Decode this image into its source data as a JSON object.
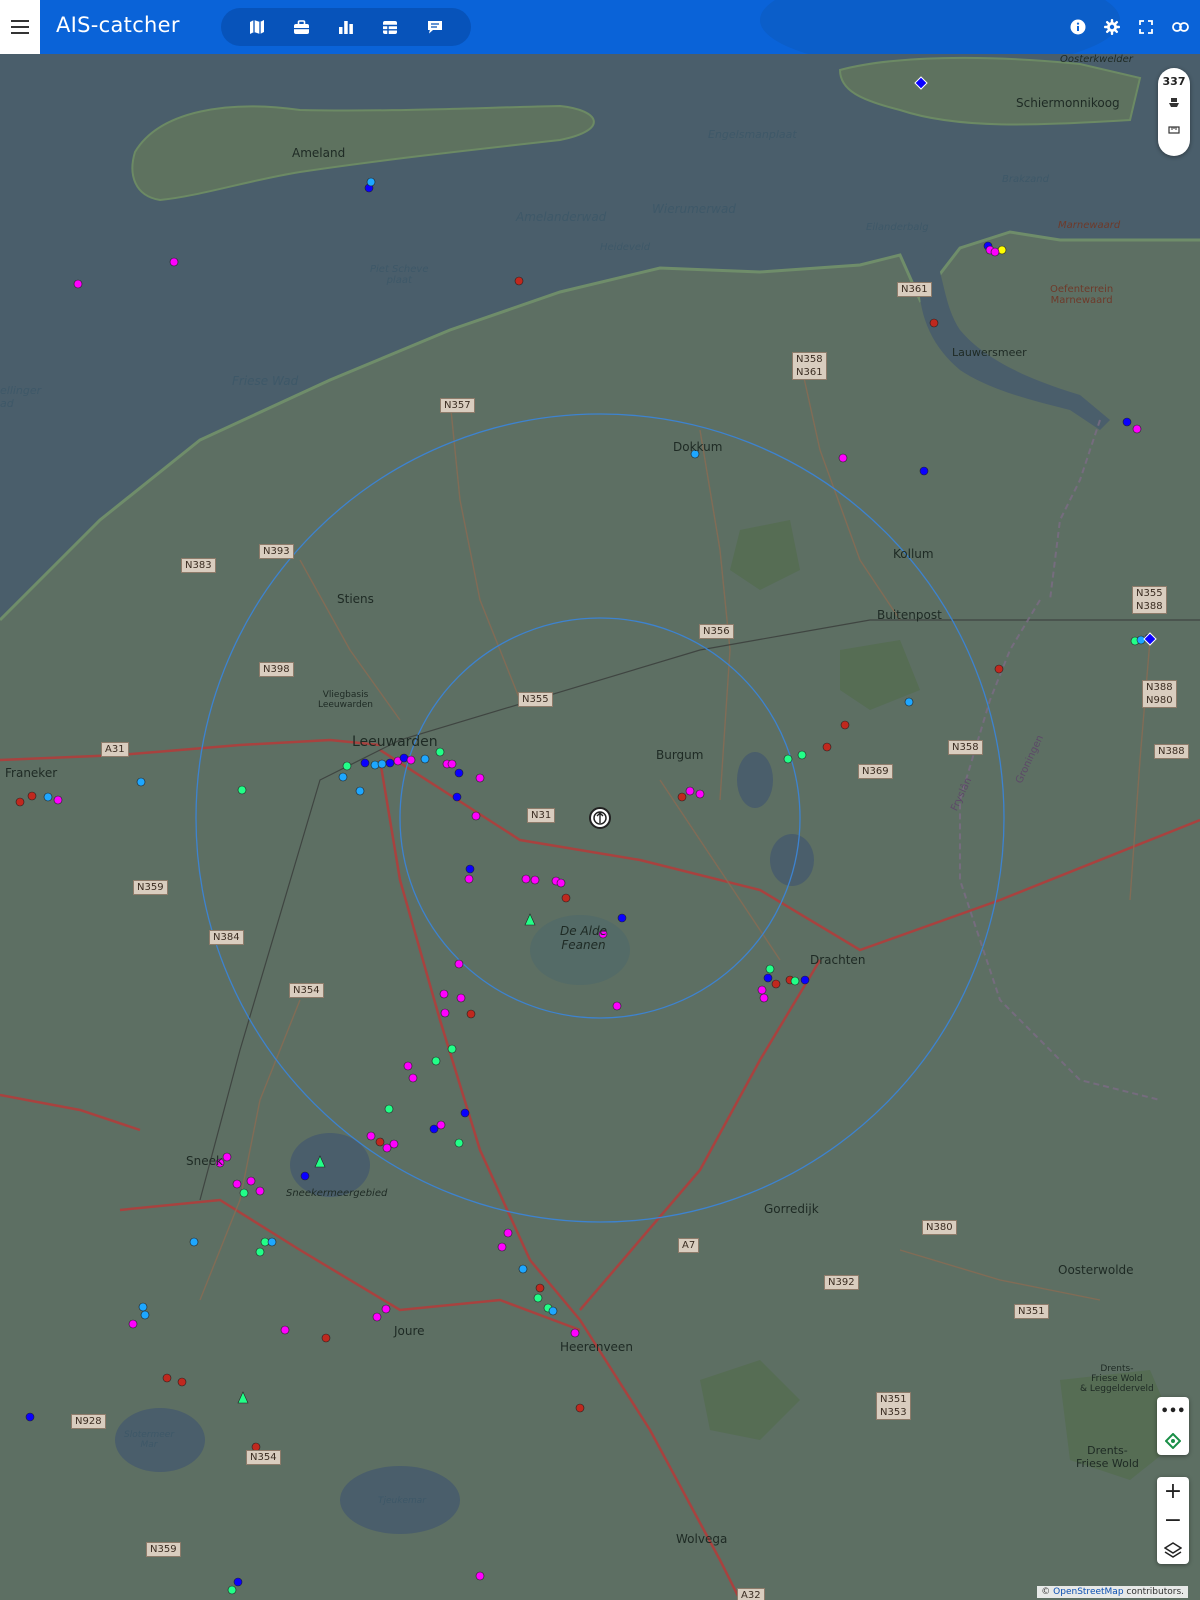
{
  "app": {
    "title": "AIS-catcher"
  },
  "header": {
    "tabs": [
      {
        "icon": "map-icon"
      },
      {
        "icon": "briefcase-icon"
      },
      {
        "icon": "bar-chart-icon"
      },
      {
        "icon": "table-icon"
      },
      {
        "icon": "message-icon"
      }
    ],
    "right_icons": [
      "info-icon",
      "settings-icon",
      "fullscreen-icon",
      "link-icon"
    ]
  },
  "controls": {
    "vessel_count": "337",
    "more_label": "•••",
    "zoom_in": "+",
    "zoom_out": "−"
  },
  "attribution": {
    "prefix": "© ",
    "link": "OpenStreetMap",
    "suffix": " contributors."
  },
  "map": {
    "places": {
      "ameland": "Ameland",
      "schiermonnikoog": "Schiermonnikoog",
      "dokkum": "Dokkum",
      "kollum": "Kollum",
      "stiens": "Stiens",
      "leeuwarden": "Leeuwarden",
      "buitenpost": "Buitenpost",
      "burgum": "Burgum",
      "franeker": "Franeker",
      "drachten": "Drachten",
      "de_alde_feanen": "De Alde\nFeanen",
      "sneek": "Sneek",
      "joure": "Joure",
      "heerenveen": "Heerenveen",
      "gorredijk": "Gorredijk",
      "oosterwolde": "Oosterwolde",
      "wolvega": "Wolvega",
      "lauwersmeer": "Lauwersmeer",
      "marnewaard": "Marnewaard",
      "oefenterrein": "Oefenterrein\nMarnewaard",
      "vliegbasis": "Vliegbasis\nLeeuwarden",
      "drents_friese_wold": "Drents-\nFriese Wold",
      "drents_friese_wold_legg": "Drents-\nFriese Wold\n& Leggelderveld",
      "groningen_border": "Groningen",
      "fryslan_border": "Fryslân",
      "sneekermeergebied": "Sneekermeergebied",
      "oosterkwelder": "Oosterkwelder"
    },
    "water_labels": {
      "engelsmanplaat": "Engelsmanplaat",
      "amelanderwad": "Amelanderwad",
      "wierumerwad": "Wierumerwad",
      "heideveld": "Heideveld",
      "piet_scheve_plaat": "Piet Scheve\nplaat",
      "friese_wad": "Friese Wad",
      "eilanderbalg": "Eilanderbalg",
      "brakzand": "Brakzand",
      "slotermeer": "Slotermeer\nMar",
      "tjeukemeer": "Tjeukemar",
      "ellinger": "ellinger\nad"
    },
    "roads": [
      "N357",
      "N361",
      "N358\nN361",
      "N393",
      "N383",
      "N398",
      "N355",
      "N356",
      "N358",
      "N369",
      "N31",
      "N359",
      "N384",
      "N354",
      "N355\nN388",
      "N388\nN980",
      "N388",
      "N380",
      "N392",
      "N351",
      "N351\nN353",
      "A7",
      "A31",
      "A32",
      "N928",
      "N354",
      "N359"
    ],
    "station_icon": "antenna-icon"
  },
  "colors": {
    "header_bg": "#0a63d8",
    "land": "#5d6f63",
    "water": "#4a5e6b",
    "range_ring": "#3d83d0",
    "vessel_magenta": "#ff00ff",
    "vessel_blue": "#0a00ff",
    "vessel_cyan": "#1ea7ff",
    "vessel_green": "#22ff88",
    "vessel_red": "#c0281e",
    "vessel_yellow": "#ffff00"
  }
}
